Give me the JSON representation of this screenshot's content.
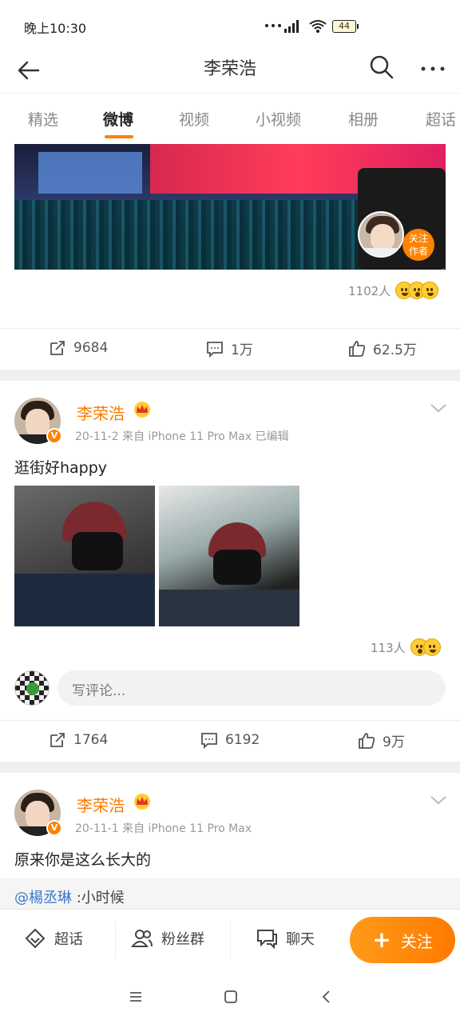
{
  "status_bar": {
    "time": "晚上10:30",
    "battery": "44"
  },
  "header": {
    "title": "李荣浩"
  },
  "tabs": [
    {
      "label": "精选"
    },
    {
      "label": "微博"
    },
    {
      "label": "视频"
    },
    {
      "label": "小视频"
    },
    {
      "label": "相册"
    },
    {
      "label": "超话"
    }
  ],
  "media_overlay": {
    "follow_author_label": "关注\n作者"
  },
  "post0": {
    "reactions_count": "1102人",
    "repost_count": "9684",
    "comment_count": "1万",
    "like_count": "62.5万"
  },
  "post1": {
    "author": "李荣浩",
    "verified_badge": "V",
    "meta": "20-11-2  来自 iPhone 11 Pro Max  已编辑",
    "text": "逛街好happy",
    "reactions_count": "113人",
    "comment_placeholder": "写评论...",
    "repost_count": "1764",
    "comment_count": "6192",
    "like_count": "9万"
  },
  "post2": {
    "author": "李荣浩",
    "verified_badge": "V",
    "meta": "20-11-1  来自 iPhone 11 Pro Max",
    "text": "原来你是这么长大的",
    "quote_mention": "@楊丞琳",
    "quote_text": " :小时候"
  },
  "bottom_bar": {
    "supertopic_label": "超话",
    "fangroup_label": "粉丝群",
    "chat_label": "聊天",
    "follow_label": "关注"
  },
  "colors": {
    "accent": "#ff8200",
    "name": "#ff7a00",
    "mention": "#3a78c8"
  },
  "icons": [
    "back-arrow-icon",
    "search-icon",
    "more-icon",
    "repost-icon",
    "comment-icon",
    "like-icon",
    "crown-icon",
    "chevron-down-icon",
    "diamond-icon",
    "group-icon",
    "chat-icon",
    "plus-icon",
    "menu-icon",
    "home-square-icon",
    "back-triangle-icon"
  ]
}
